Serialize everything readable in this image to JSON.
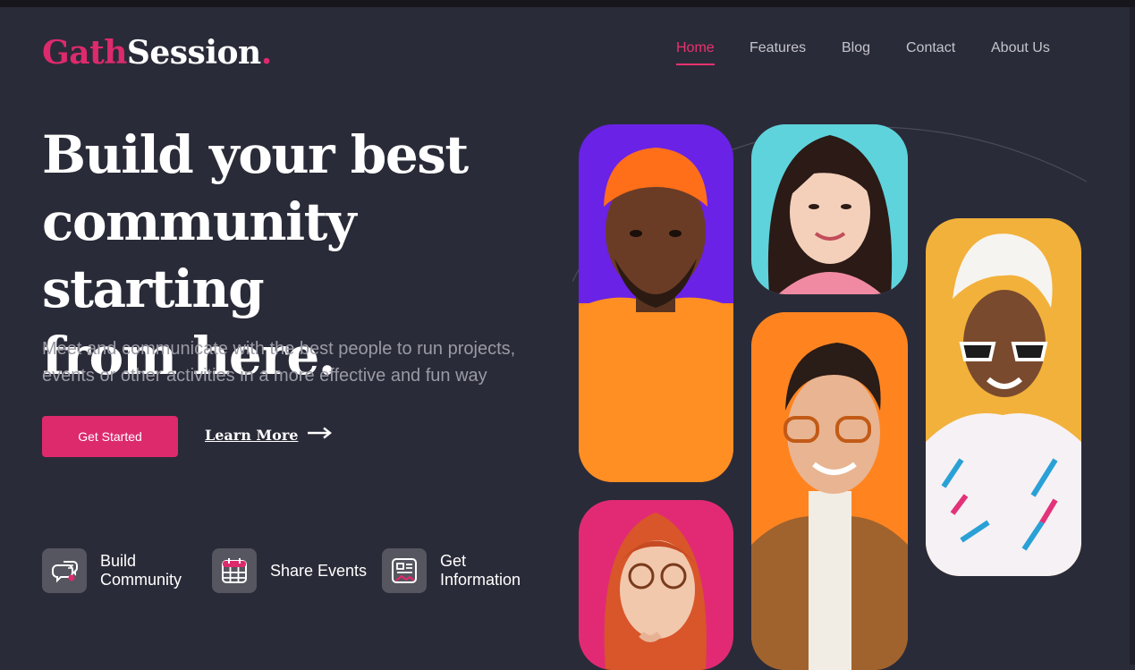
{
  "brand": {
    "part1": "Gath",
    "part2": "Session",
    "dot": ".",
    "accent": "#dd2a6d"
  },
  "nav": {
    "items": [
      {
        "label": "Home",
        "active": true
      },
      {
        "label": "Features",
        "active": false
      },
      {
        "label": "Blog",
        "active": false
      },
      {
        "label": "Contact",
        "active": false
      },
      {
        "label": "About Us",
        "active": false
      }
    ]
  },
  "hero": {
    "title_line1": "Build your best",
    "title_line2": "community starting",
    "title_line3": "from here.",
    "subtitle_line1": "Meet and communicate with the best people to run projects,",
    "subtitle_line2": "events or other activities in a more effective and fun way",
    "primary_button": "Get Started",
    "secondary_link": "Learn More"
  },
  "features": [
    {
      "icon": "chat-icon",
      "label_line1": "Build",
      "label_line2": "Community"
    },
    {
      "icon": "calendar-icon",
      "label_line1": "Share Events",
      "label_line2": ""
    },
    {
      "icon": "newspaper-icon",
      "label_line1": "Get",
      "label_line2": "Information"
    }
  ],
  "photos": [
    {
      "subject": "man-orange-beanie",
      "bg": "#6a22e6"
    },
    {
      "subject": "woman-smiling",
      "bg": "#5fd3dc"
    },
    {
      "subject": "woman-sunglasses",
      "bg": "#f2b13b"
    },
    {
      "subject": "man-glasses",
      "bg": "#ff8420"
    },
    {
      "subject": "woman-redhead-glasses",
      "bg": "#e22a74"
    }
  ],
  "colors": {
    "background": "#2a2b38",
    "accent": "#dd2a6d",
    "muted_text": "#9a9aa5"
  }
}
